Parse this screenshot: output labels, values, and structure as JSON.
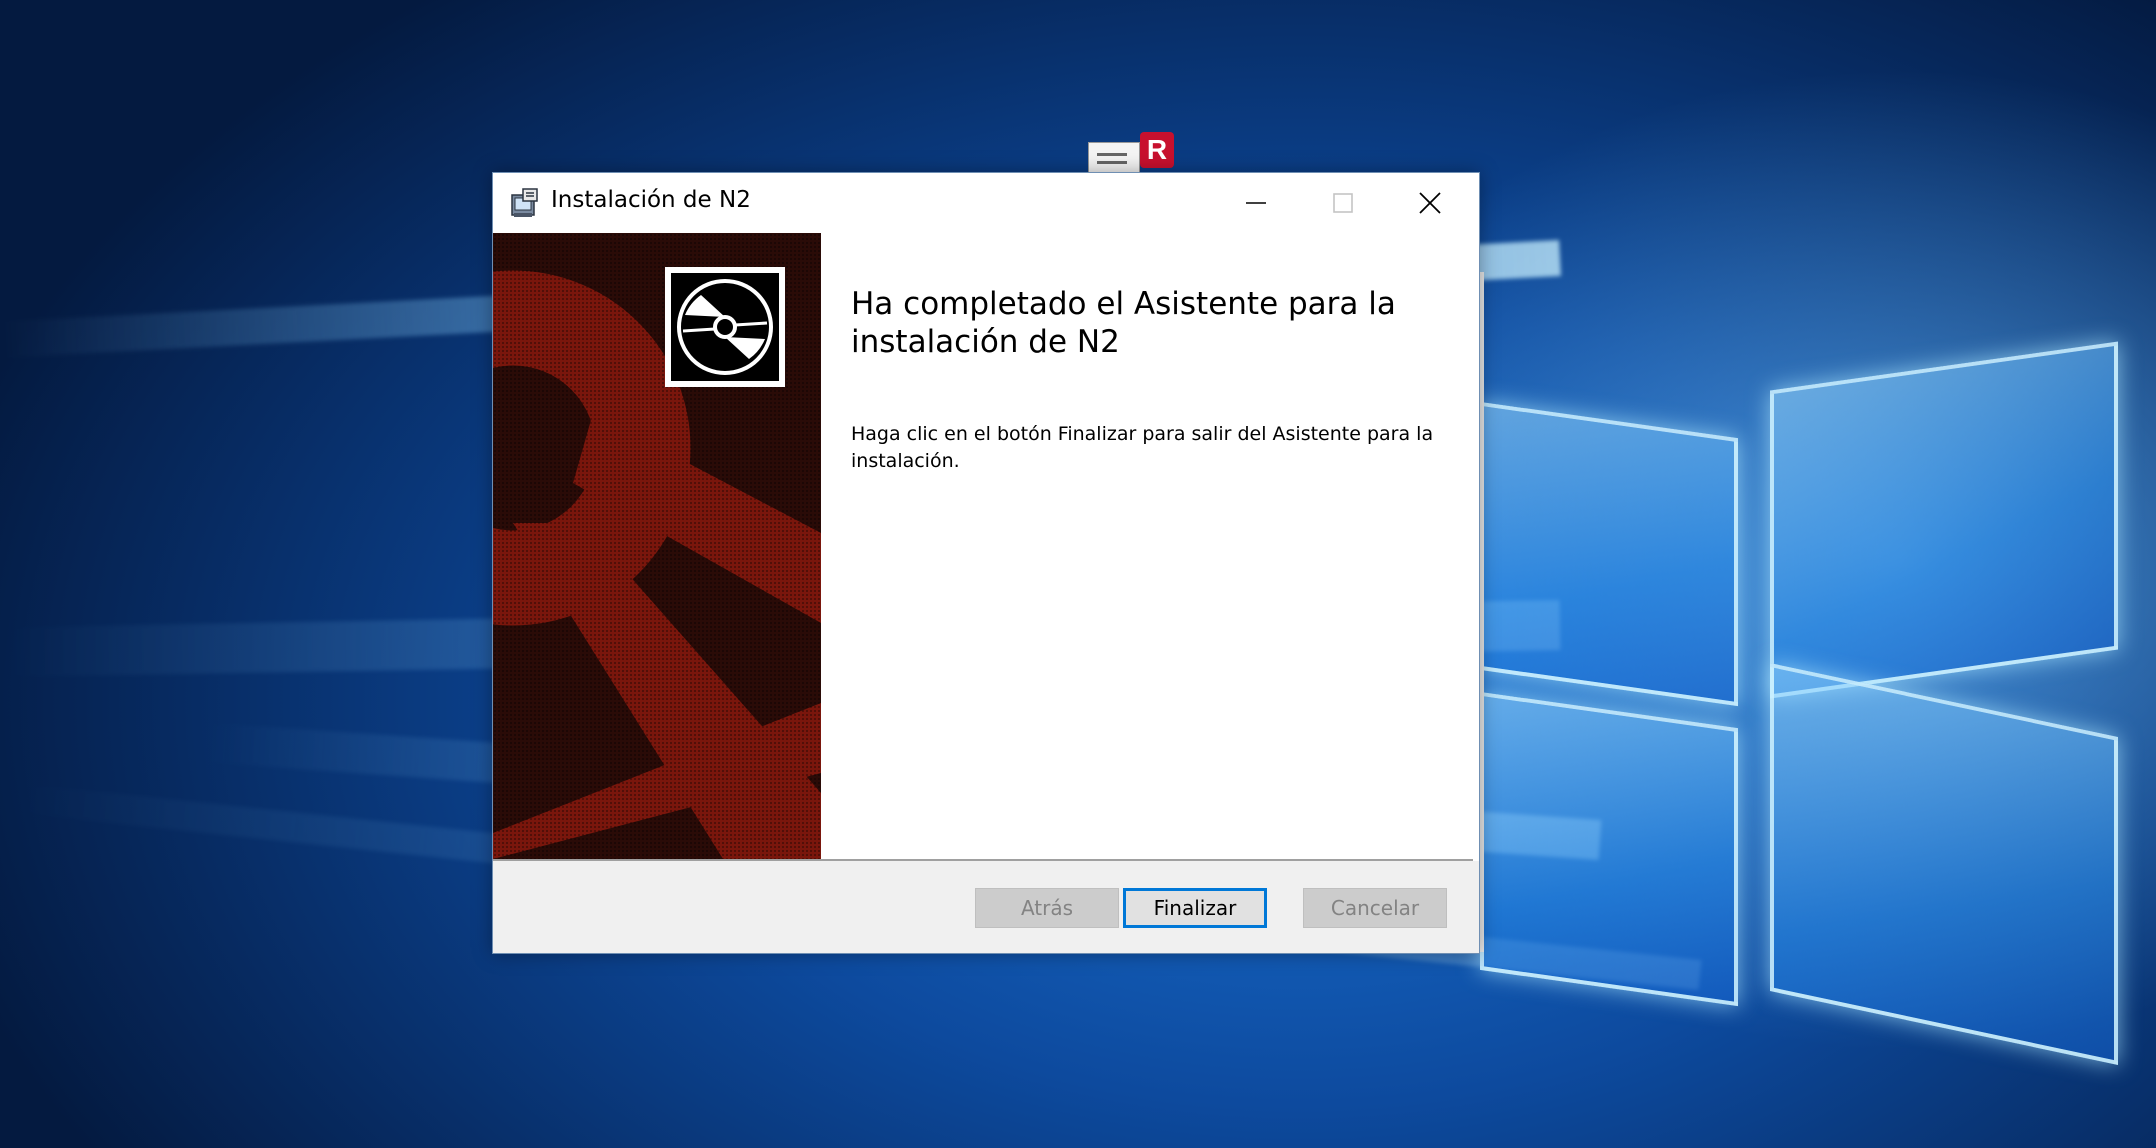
{
  "desktop": {
    "icon_label": "",
    "icon_badge": "R",
    "colors": {
      "wallpaper_dark": "#072b62",
      "wallpaper_light": "#1a72d4",
      "logo_glow": "#d2f5ff"
    }
  },
  "dialog": {
    "title": "Instalación de N2",
    "title_icon": "installer-icon",
    "controls": {
      "minimize_icon": "minimize-icon",
      "maximize_icon": "maximize-icon",
      "close_icon": "close-icon"
    },
    "banner": {
      "background_color": "#7a160c",
      "graphic_icon": "cd-disc-icon"
    },
    "heading": "Ha completado el Asistente para la instalación de N2",
    "body": "Haga clic en el botón Finalizar para salir del Asistente para la instalación.",
    "buttons": {
      "back_label": "Atrás",
      "finish_label": "Finalizar",
      "cancel_label": "Cancelar"
    },
    "colors": {
      "focus_border": "#0078d7",
      "footer_bg": "#f0f0f0"
    }
  }
}
